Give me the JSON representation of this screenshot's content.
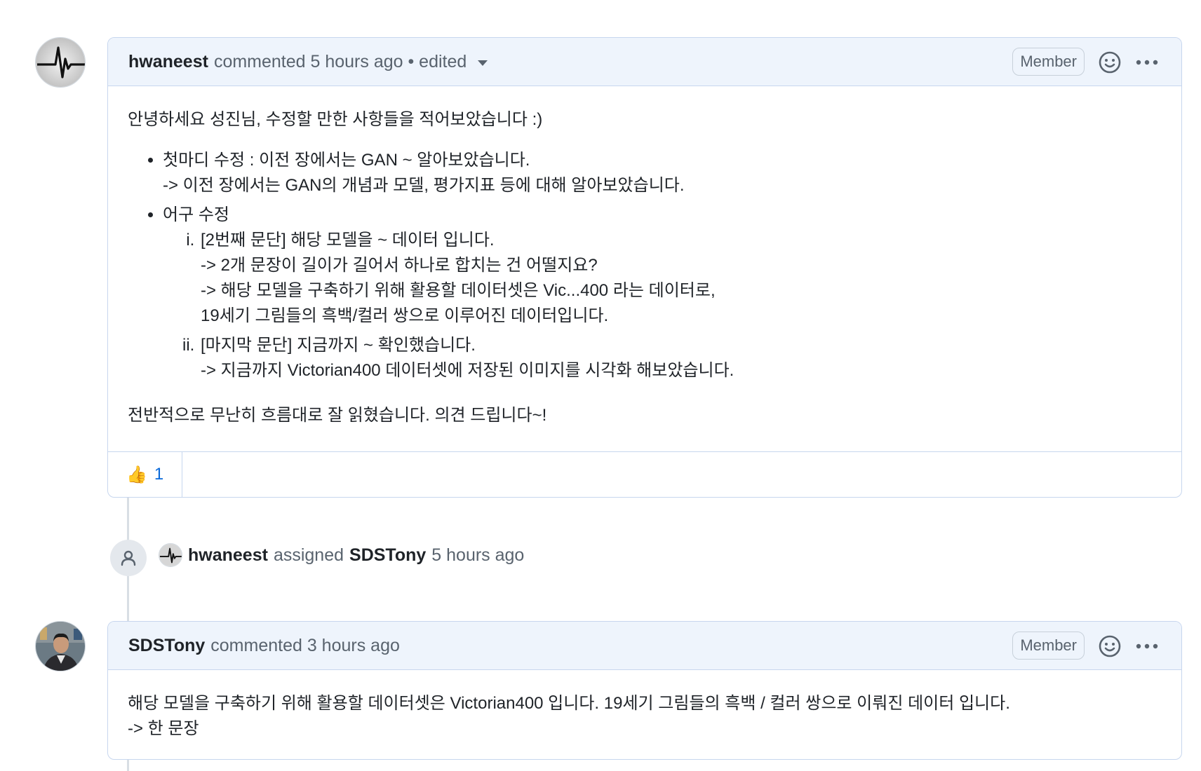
{
  "comment1": {
    "author": "hwaneest",
    "meta": "commented 5 hours ago • edited",
    "badge": "Member",
    "greeting": "안녕하세요 성진님, 수정할 만한 사항들을 적어보았습니다 :)",
    "item1_line1": "첫마디 수정 : 이전 장에서는 GAN ~ 알아보았습니다.",
    "item1_line2": "-> 이전 장에서는 GAN의 개념과 모델, 평가지표 등에 대해 알아보았습니다.",
    "item2_title": "어구 수정",
    "sub1_line1": "[2번째 문단] 해당 모델을 ~ 데이터 입니다.",
    "sub1_line2": "-> 2개 문장이 길이가 길어서 하나로 합치는 건 어떨지요?",
    "sub1_line3": "-> 해당 모델을 구축하기 위해 활용할 데이터셋은 Vic...400 라는 데이터로,",
    "sub1_line4": "19세기 그림들의 흑백/컬러 쌍으로 이루어진 데이터입니다.",
    "sub2_line1": "[마지막 문단] 지금까지 ~ 확인했습니다.",
    "sub2_line2": "-> 지금까지 Victorian400 데이터셋에 저장된 이미지를 시각화 해보았습니다.",
    "closing": "전반적으로 무난히 흐름대로 잘 읽혔습니다. 의견 드립니다~!",
    "reaction_emoji": "👍",
    "reaction_count": "1"
  },
  "event": {
    "actor": "hwaneest",
    "action": "assigned",
    "target": "SDSTony",
    "time": "5 hours ago"
  },
  "comment2": {
    "author": "SDSTony",
    "meta": "commented 3 hours ago",
    "badge": "Member",
    "line1": "해당 모델을 구축하기 위해 활용할 데이터셋은 Victorian400 입니다. 19세기 그림들의 흑백 / 컬러 쌍으로 이뤄진 데이터 입니다.",
    "line2": "-> 한 문장"
  }
}
